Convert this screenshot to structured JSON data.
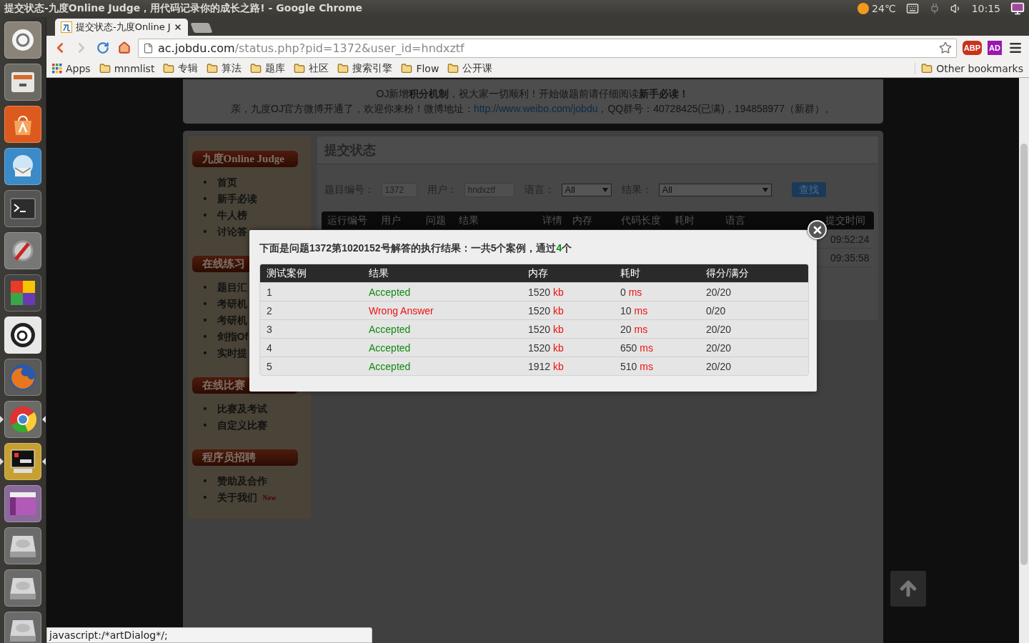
{
  "top_panel": {
    "title": "提交状态-九度Online Judge，用代码记录你的成长之路! - Google Chrome",
    "weather": "24℃",
    "clock": "10:15"
  },
  "launcher": [
    {
      "kind": "dash",
      "running": false
    },
    {
      "kind": "files",
      "running": false
    },
    {
      "kind": "software",
      "running": false
    },
    {
      "kind": "mail",
      "running": false
    },
    {
      "kind": "terminal",
      "running": false
    },
    {
      "kind": "settings",
      "running": false
    },
    {
      "kind": "office",
      "running": false
    },
    {
      "kind": "amazon",
      "running": false
    },
    {
      "kind": "firefox",
      "running": false
    },
    {
      "kind": "chrome",
      "running": true
    },
    {
      "kind": "xterm",
      "running": true
    },
    {
      "kind": "window",
      "running": false
    },
    {
      "kind": "disk",
      "running": false
    },
    {
      "kind": "disk",
      "running": false
    },
    {
      "kind": "disk",
      "running": false
    }
  ],
  "browser": {
    "tabs": [
      {
        "title": "提交状态-九度Online J",
        "selected": true
      }
    ],
    "url_host": "ac.jobdu.com",
    "url_path": "/status.php?pid=1372&user_id=hndxztf",
    "extensions": [
      {
        "kind": "abp",
        "label": "ABP"
      },
      {
        "kind": "ad",
        "label": "AD"
      }
    ],
    "bookmarks": [
      {
        "kind": "apps",
        "label": "Apps"
      },
      {
        "kind": "folder",
        "label": "mnmlist"
      },
      {
        "kind": "folder",
        "label": "专辑"
      },
      {
        "kind": "folder",
        "label": "算法"
      },
      {
        "kind": "folder",
        "label": "题库"
      },
      {
        "kind": "folder",
        "label": "社区"
      },
      {
        "kind": "folder",
        "label": "搜索引擎"
      },
      {
        "kind": "folder",
        "label": "Flow"
      },
      {
        "kind": "folder",
        "label": "公开课"
      }
    ],
    "other_bookmarks": "Other bookmarks",
    "status_bubble": "javascript:/*artDialog*/;"
  },
  "notice": {
    "line1": "OJ新增**积分机制**，祝大家一切顺利！开始做题前请仔细阅读**新手必读！**",
    "line2_before": "亲，九度OJ官方微博开通了，欢迎你来粉！微博地址：",
    "line2_link": "http://www.weibo.com/jobdu",
    "line2_after": "，QQ群号：40728425(已满)，194858977（新群）。"
  },
  "sidebar": [
    {
      "title": "九度Online Judge",
      "items": [
        {
          "bullet": "•",
          "label": "首页"
        },
        {
          "bullet": "•",
          "label": "新手必读"
        },
        {
          "bullet": "•",
          "label": "牛人榜"
        },
        {
          "bullet": "•",
          "label": "讨论答"
        }
      ]
    },
    {
      "title": "在线练习",
      "items": [
        {
          "bullet": "•",
          "label": "题目汇"
        },
        {
          "bullet": "•",
          "label": "考研机"
        },
        {
          "bullet": "•",
          "label": "考研机"
        },
        {
          "bullet": "•",
          "label": "剑指Of"
        },
        {
          "bullet": "•",
          "label": "实时提"
        }
      ]
    },
    {
      "title": "在线比赛",
      "items": [
        {
          "bullet": "•",
          "label": "比赛及考试"
        },
        {
          "bullet": "•",
          "label": "自定义比赛"
        }
      ]
    },
    {
      "title": "程序员招聘",
      "items": [
        {
          "bullet": "•",
          "label": "赞助及合作"
        },
        {
          "bullet": "•",
          "label": "关于我们",
          "badge": "New"
        }
      ]
    }
  ],
  "content": {
    "title": "提交状态",
    "filters": [
      {
        "kind": "input",
        "label": "题目编号：",
        "value": "1372"
      },
      {
        "kind": "input",
        "label": "用户：",
        "value": "hndxztf"
      },
      {
        "kind": "select",
        "label": "语言：",
        "value": "All"
      },
      {
        "kind": "select",
        "label": "结果：",
        "value": "All"
      }
    ],
    "search_button": "查找",
    "status_table": {
      "columns": [
        "运行编号",
        "用户",
        "问题",
        "结果",
        "详情",
        "内存",
        "代码长度",
        "耗时",
        "语言",
        "提交时间"
      ],
      "rows": [
        {
          "submit_time": "09:52:24"
        },
        {
          "submit_time": "09:35:58"
        }
      ]
    }
  },
  "dialog": {
    "summary_before": "下面是问题1372第1020152号解答的执行结果：一共5个案例，通过",
    "passed": "4",
    "summary_after": "个",
    "columns": [
      "测试案例",
      "结果",
      "内存",
      "耗时",
      "得分/满分"
    ],
    "rows": [
      {
        "case": "1",
        "result": "Accepted",
        "color": "#118811",
        "memory": "1520",
        "memory_unit": "kb",
        "time": "0",
        "time_unit": "ms",
        "score": "20/20"
      },
      {
        "case": "2",
        "result": "Wrong Answer",
        "color": "#ee1111",
        "memory": "1520",
        "memory_unit": "kb",
        "time": "10",
        "time_unit": "ms",
        "score": "0/20"
      },
      {
        "case": "3",
        "result": "Accepted",
        "color": "#118811",
        "memory": "1520",
        "memory_unit": "kb",
        "time": "20",
        "time_unit": "ms",
        "score": "20/20"
      },
      {
        "case": "4",
        "result": "Accepted",
        "color": "#118811",
        "memory": "1520",
        "memory_unit": "kb",
        "time": "650",
        "time_unit": "ms",
        "score": "20/20"
      },
      {
        "case": "5",
        "result": "Accepted",
        "color": "#118811",
        "memory": "1912",
        "memory_unit": "kb",
        "time": "510",
        "time_unit": "ms",
        "score": "20/20"
      }
    ]
  }
}
